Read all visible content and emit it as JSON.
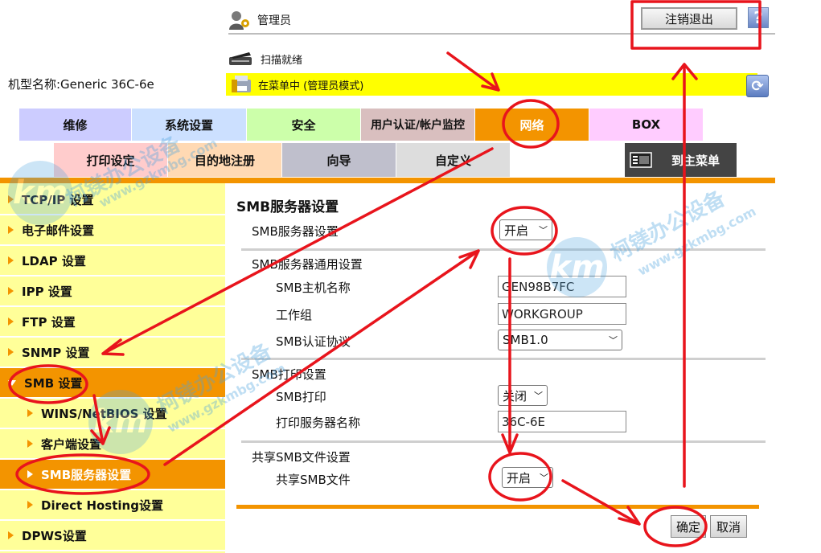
{
  "header": {
    "user_label": "管理员",
    "logout_label": "注销退出",
    "help_label": "?",
    "status_scan": "扫描就绪",
    "status_menu": "在菜单中 (管理员模式)",
    "model_name": "机型名称:Generic 36C-6e",
    "refresh_label": "⟳"
  },
  "tabs_row1": [
    {
      "label": "维修",
      "color": "#ccccff"
    },
    {
      "label": "系统设置",
      "color": "#cce0ff"
    },
    {
      "label": "安全",
      "color": "#ccffaa"
    },
    {
      "label": "用户认证/帐户监控",
      "color": "#d9bfbf"
    },
    {
      "label": "网络",
      "color": "#f39400"
    },
    {
      "label": "BOX",
      "color": "#ffccff"
    }
  ],
  "tabs_row2": [
    {
      "label": "打印设定",
      "color": "#ffcccc"
    },
    {
      "label": "目的地注册",
      "color": "#ffd9b3"
    },
    {
      "label": "向导",
      "color": "#bfbfcc"
    },
    {
      "label": "自定义",
      "color": "#dddddd"
    }
  ],
  "main_menu_label": "到主菜单",
  "sidebar": [
    {
      "label": "TCP/IP 设置",
      "kind": "top"
    },
    {
      "label": "电子邮件设置",
      "kind": "top"
    },
    {
      "label": "LDAP 设置",
      "kind": "top"
    },
    {
      "label": "IPP 设置",
      "kind": "top"
    },
    {
      "label": "FTP 设置",
      "kind": "top"
    },
    {
      "label": "SNMP 设置",
      "kind": "top"
    },
    {
      "label": "SMB 设置",
      "kind": "expanded"
    },
    {
      "label": "WINS/NetBIOS 设置",
      "kind": "sub"
    },
    {
      "label": "客户端设置",
      "kind": "sub"
    },
    {
      "label": "SMB服务器设置",
      "kind": "sub-active"
    },
    {
      "label": "Direct Hosting设置",
      "kind": "sub"
    },
    {
      "label": "DPWS设置",
      "kind": "top"
    }
  ],
  "main": {
    "title": "SMB服务器设置",
    "server_label": "SMB服务器设置",
    "server_value": "开启",
    "general_section": "SMB服务器通用设置",
    "host_label": "SMB主机名称",
    "host_value": "GEN98B7FC",
    "workgroup_label": "工作组",
    "workgroup_value": "WORKGROUP",
    "auth_label": "SMB认证协议",
    "auth_value": "SMB1.0",
    "print_section": "SMB打印设置",
    "print_label": "SMB打印",
    "print_value": "关闭",
    "print_server_label": "打印服务器名称",
    "print_server_value": "36C-6E",
    "share_section": "共享SMB文件设置",
    "share_label": "共享SMB文件",
    "share_value": "开启",
    "ok_label": "确定",
    "cancel_label": "取消"
  },
  "watermark": {
    "text_cn": "柯镁办公设备",
    "text_url": "www.gzkmbg.com",
    "badge": "km"
  },
  "annotation_color": "#e8141c"
}
